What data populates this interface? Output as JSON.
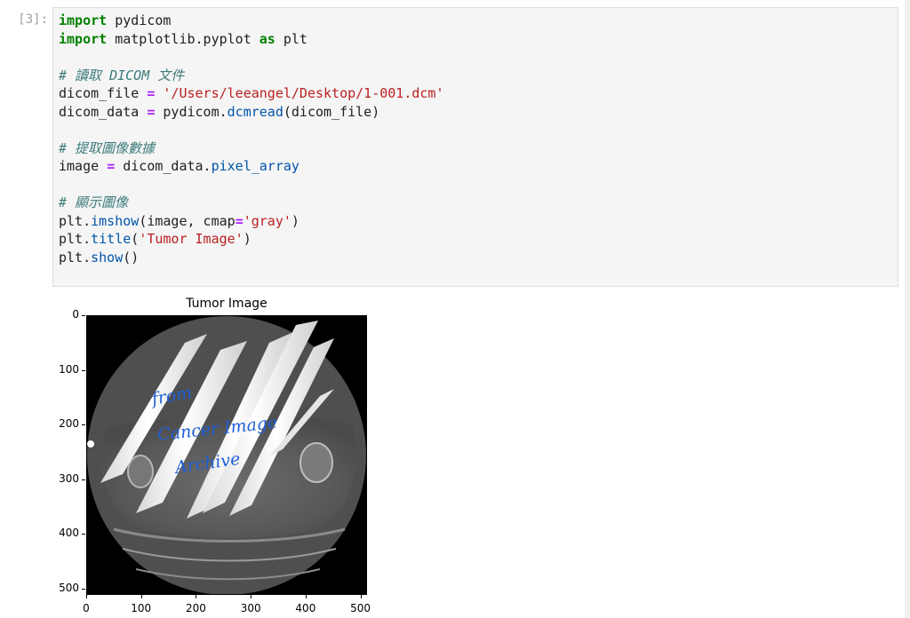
{
  "cell": {
    "prompt": "[3]:",
    "code_lines": [
      [
        {
          "t": "import",
          "c": "kw"
        },
        {
          "t": " pydicom"
        }
      ],
      [
        {
          "t": "import",
          "c": "kw"
        },
        {
          "t": " matplotlib.pyplot "
        },
        {
          "t": "as",
          "c": "kw"
        },
        {
          "t": " plt"
        }
      ],
      [],
      [
        {
          "t": "# 讀取 DICOM 文件",
          "c": "cm"
        }
      ],
      [
        {
          "t": "dicom_file "
        },
        {
          "t": "=",
          "c": "op"
        },
        {
          "t": " "
        },
        {
          "t": "'/Users/leeangel/Desktop/1-001.dcm'",
          "c": "str"
        }
      ],
      [
        {
          "t": "dicom_data "
        },
        {
          "t": "=",
          "c": "op"
        },
        {
          "t": " pydicom."
        },
        {
          "t": "dcmread",
          "c": "fn"
        },
        {
          "t": "(dicom_file)"
        }
      ],
      [],
      [
        {
          "t": "# 提取圖像數據",
          "c": "cm"
        }
      ],
      [
        {
          "t": "image "
        },
        {
          "t": "=",
          "c": "op"
        },
        {
          "t": " dicom_data."
        },
        {
          "t": "pixel_array",
          "c": "fn"
        }
      ],
      [],
      [
        {
          "t": "# 顯示圖像",
          "c": "cm"
        }
      ],
      [
        {
          "t": "plt."
        },
        {
          "t": "imshow",
          "c": "fn"
        },
        {
          "t": "(image, cmap"
        },
        {
          "t": "=",
          "c": "op"
        },
        {
          "t": "'gray'",
          "c": "str"
        },
        {
          "t": ")"
        }
      ],
      [
        {
          "t": "plt."
        },
        {
          "t": "title",
          "c": "fn"
        },
        {
          "t": "("
        },
        {
          "t": "'Tumor Image'",
          "c": "str"
        },
        {
          "t": ")"
        }
      ],
      [
        {
          "t": "plt."
        },
        {
          "t": "show",
          "c": "fn"
        },
        {
          "t": "()"
        }
      ]
    ]
  },
  "plot": {
    "title": "Tumor Image",
    "y_ticks": [
      {
        "label": "0",
        "value": 0
      },
      {
        "label": "100",
        "value": 100
      },
      {
        "label": "200",
        "value": 200
      },
      {
        "label": "300",
        "value": 300
      },
      {
        "label": "400",
        "value": 400
      },
      {
        "label": "500",
        "value": 500
      }
    ],
    "x_ticks": [
      {
        "label": "0",
        "value": 0
      },
      {
        "label": "100",
        "value": 100
      },
      {
        "label": "200",
        "value": 200
      },
      {
        "label": "300",
        "value": 300
      },
      {
        "label": "400",
        "value": 400
      },
      {
        "label": "500",
        "value": 500
      }
    ],
    "x_range": [
      0,
      512
    ],
    "y_range": [
      0,
      512
    ],
    "cmap": "gray",
    "watermark": [
      "from",
      "Cancer Image",
      "Archive"
    ],
    "watermark_color": "#1e5fd8"
  }
}
